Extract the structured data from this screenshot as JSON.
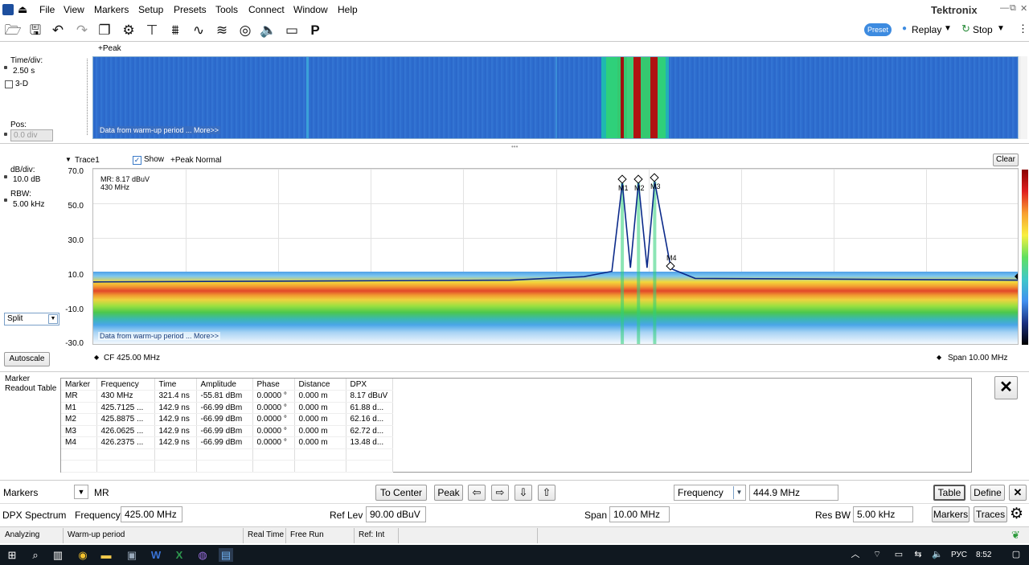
{
  "menu": [
    "File",
    "View",
    "Markers",
    "Setup",
    "Presets",
    "Tools",
    "Connect",
    "Window",
    "Help"
  ],
  "brand": "Tektronix",
  "toolbar": {
    "icons": [
      "open-icon",
      "save-icon",
      "undo-icon",
      "redo-icon",
      "windows-icon",
      "gear-icon",
      "trigger-icon",
      "acquire-icon",
      "analysis-icon",
      "amplitude-icon",
      "replay-disk-icon",
      "audio-icon",
      "record-icon",
      "preset-p-icon"
    ],
    "preset": "Preset",
    "replay": "Replay",
    "stop": "Stop"
  },
  "spectrogram": {
    "trace_label": "+Peak",
    "time_div_label": "Time/div:",
    "time_div_value": "2.50 s",
    "three_d_label": "3-D",
    "pos_label": "Pos:",
    "pos_value": "0.0 div",
    "warmup_note": "Data from warm-up period ... More>>"
  },
  "spectrum": {
    "trace_name": "Trace1",
    "show_label": "Show",
    "trace_mode": "+Peak Normal",
    "clear_label": "Clear",
    "db_div_label": "dB/div:",
    "db_div_value": "10.0 dB",
    "rbw_label": "RBW:",
    "rbw_value": "5.00 kHz",
    "split_option": "Split",
    "autoscale_label": "Autoscale",
    "readout_line1": "MR: 8.17 dBuV",
    "readout_line2": "430 MHz",
    "y_ticks": [
      "70.0",
      "50.0",
      "30.0",
      "10.0",
      "-10.0",
      "-30.0"
    ],
    "cf_label": "CF  425.00 MHz",
    "span_label": "Span  10.00 MHz",
    "warmup_note": "Data from warm-up period ... More>>",
    "marker_labels": [
      "M1",
      "M2",
      "M3",
      "M4"
    ]
  },
  "chart_data": {
    "type": "line",
    "xlabel": "",
    "ylabel": "",
    "x_range_mhz": [
      420.0,
      430.0
    ],
    "ylim": [
      -30,
      70
    ],
    "grid": true,
    "series": [
      {
        "x": [
          420.0,
          424.5,
          425.3,
          425.6,
          425.7125,
          425.8,
          425.8875,
          425.98,
          426.0625,
          426.2375,
          426.5,
          430.0
        ],
        "values": [
          6,
          7,
          9,
          12,
          61.88,
          14,
          62.16,
          14,
          62.72,
          13.48,
          8,
          7
        ]
      }
    ]
  },
  "marker_readout": {
    "title": "Marker Readout Table",
    "columns": [
      "Marker",
      "Frequency",
      "Time",
      "Amplitude",
      "Phase",
      "Distance",
      "DPX"
    ],
    "rows": [
      [
        "MR",
        "430 MHz",
        "321.4 ns",
        "-55.81 dBm",
        "0.0000 °",
        "0.000 m",
        "8.17 dBuV"
      ],
      [
        "M1",
        "425.7125 ...",
        "142.9 ns",
        "-66.99 dBm",
        "0.0000 °",
        "0.000 m",
        "61.88 d..."
      ],
      [
        "M2",
        "425.8875 ...",
        "142.9 ns",
        "-66.99 dBm",
        "0.0000 °",
        "0.000 m",
        "62.16 d..."
      ],
      [
        "M3",
        "426.0625 ...",
        "142.9 ns",
        "-66.99 dBm",
        "0.0000 °",
        "0.000 m",
        "62.72 d..."
      ],
      [
        "M4",
        "426.2375 ...",
        "142.9 ns",
        "-66.99 dBm",
        "0.0000 °",
        "0.000 m",
        "13.48 d..."
      ]
    ]
  },
  "markers_bar": {
    "label": "Markers",
    "selected": "MR",
    "to_center": "To Center",
    "peak": "Peak",
    "param": "Frequency",
    "param_value": "444.9 MHz",
    "table": "Table",
    "define": "Define"
  },
  "settings_bar": {
    "title": "DPX Spectrum",
    "freq_label": "Frequency",
    "freq_value": "425.00 MHz",
    "reflev_label": "Ref Lev",
    "reflev_value": "90.00 dBuV",
    "span_label": "Span",
    "span_value": "10.00 MHz",
    "resbw_label": "Res BW",
    "resbw_value": "5.00 kHz",
    "markers_btn": "Markers",
    "traces_btn": "Traces"
  },
  "status": {
    "s1": "Analyzing",
    "s2": "Warm-up period",
    "s3": "Real Time",
    "s4": "Free Run",
    "s5": "Ref: Int"
  },
  "taskbar": {
    "lang": "РУС",
    "time": "8:52"
  }
}
